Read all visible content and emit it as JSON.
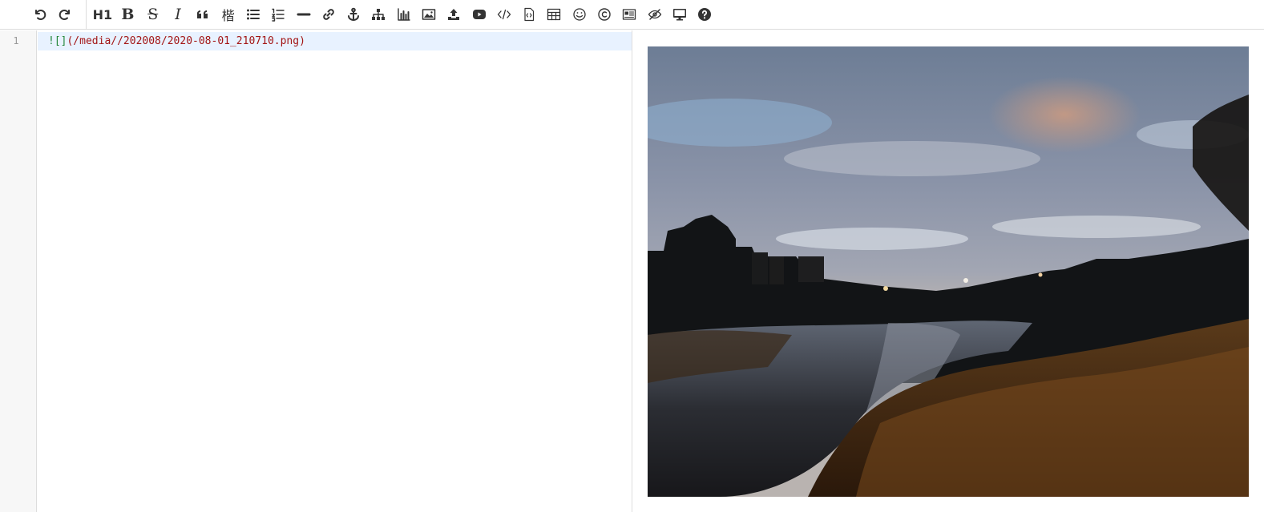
{
  "toolbar": {
    "history": [
      {
        "name": "undo-icon",
        "title": "Undo"
      },
      {
        "name": "redo-icon",
        "title": "Redo"
      }
    ],
    "heading_label": "H1",
    "bold_label": "B",
    "strike_label": "S",
    "italic_label": "I",
    "cjk_label": "楷"
  },
  "editor": {
    "line_number": "1",
    "markdown_bang": "![]",
    "markdown_url": "(/media//202008/2020-08-01_210710.png)"
  },
  "preview": {
    "image_desc_icon": "photo"
  }
}
